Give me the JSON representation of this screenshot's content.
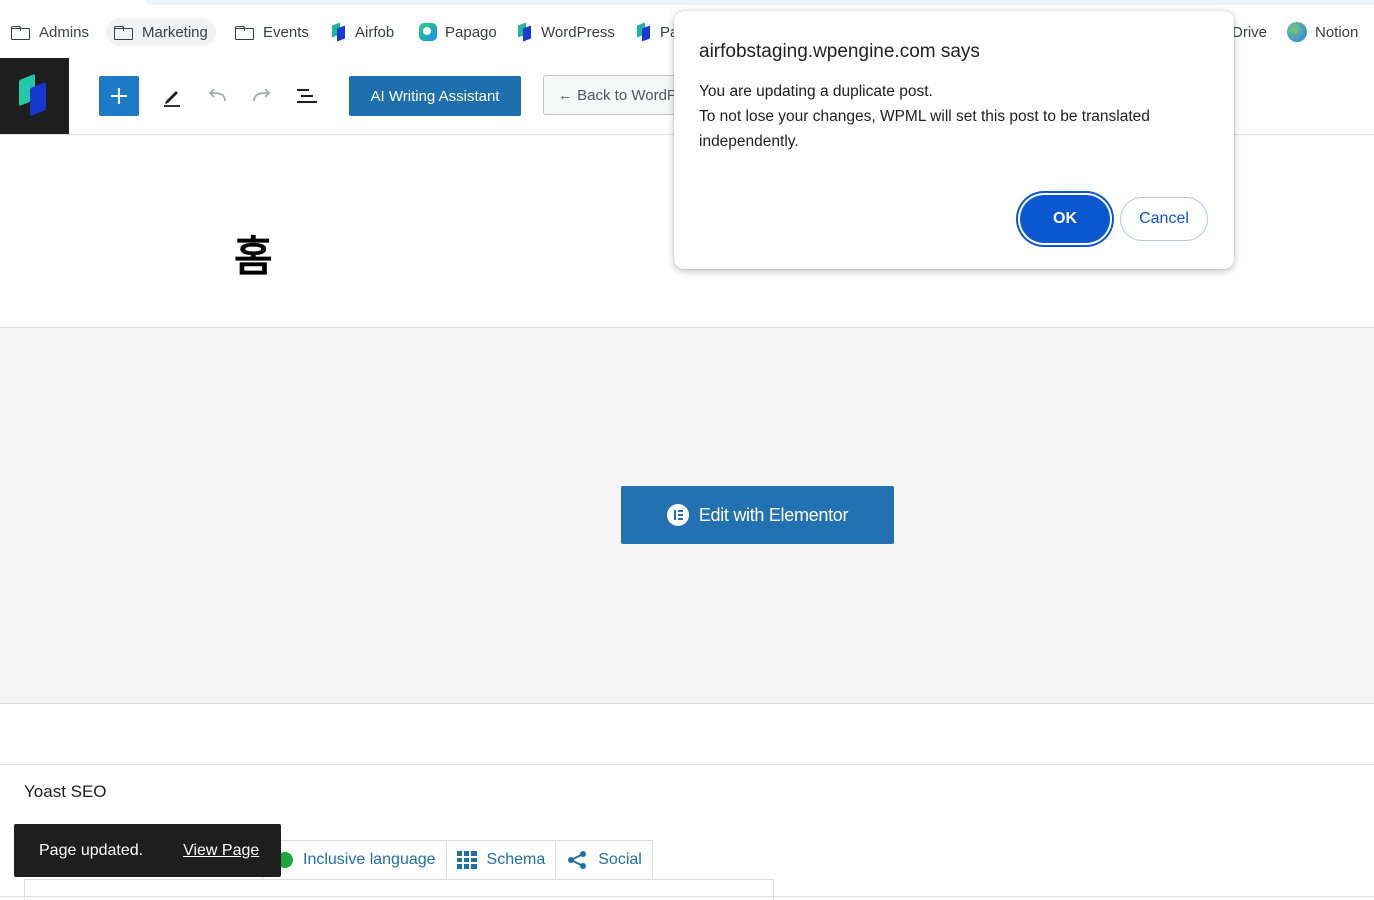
{
  "bookmarks": [
    {
      "label": "Admins",
      "icon": "folder-icon"
    },
    {
      "label": "Marketing",
      "icon": "folder-icon"
    },
    {
      "label": "Events",
      "icon": "folder-icon"
    },
    {
      "label": "Airfob",
      "icon": "airfob-icon"
    },
    {
      "label": "Papago",
      "icon": "papago-icon"
    },
    {
      "label": "WordPress",
      "icon": "airfob-icon"
    },
    {
      "label": "Pa",
      "icon": "airfob-icon"
    },
    {
      "label": "Drive",
      "icon": "drive-icon"
    },
    {
      "label": "Notion",
      "icon": "globe-icon"
    }
  ],
  "toolbar": {
    "ai_label": "AI Writing Assistant",
    "back_label": "← Back to WordPress Editor"
  },
  "page": {
    "title": "홈"
  },
  "elementor": {
    "button_label": "Edit with Elementor"
  },
  "yoast": {
    "title": "Yoast SEO",
    "tabs": [
      {
        "label": "Inclusive language",
        "icon": "smile-icon"
      },
      {
        "label": "Schema",
        "icon": "grid-icon"
      },
      {
        "label": "Social",
        "icon": "share-icon"
      }
    ]
  },
  "snackbar": {
    "message": "Page updated.",
    "link": "View Page"
  },
  "dialog": {
    "title": "airfobstaging.wpengine.com says",
    "line1": "You are updating a duplicate post.",
    "line2": "To not lose your changes, WPML will set this post to be translated",
    "line3": "independently.",
    "ok_label": "OK",
    "cancel_label": "Cancel"
  },
  "colors": {
    "wp_blue": "#2271b1",
    "dialog_blue": "#0b57d0",
    "snackbar_bg": "#1e1e1e"
  }
}
